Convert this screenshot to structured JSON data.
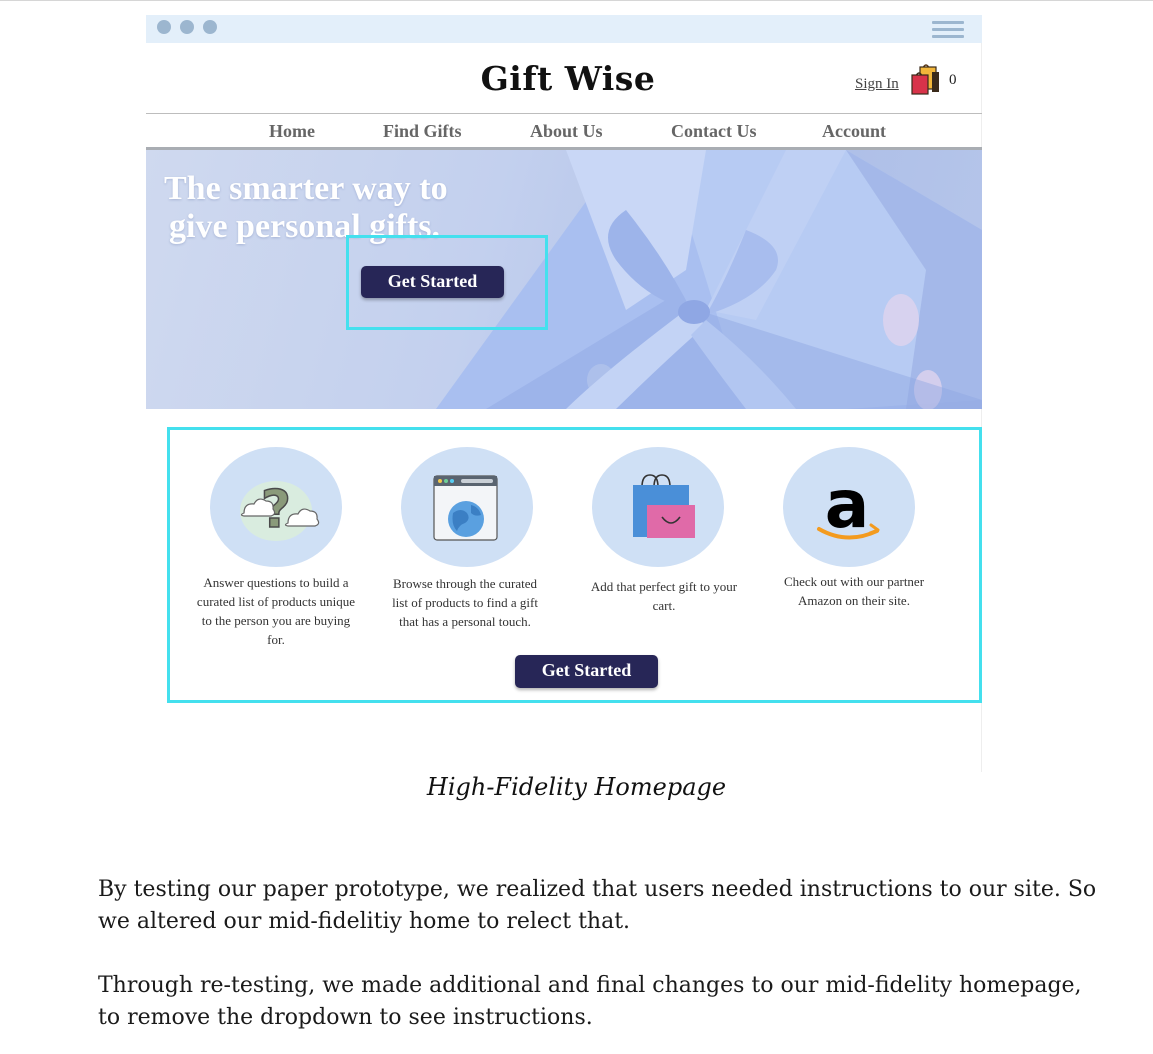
{
  "site": {
    "brand": "Gift Wise",
    "sign_in": "Sign In",
    "cart_count": "0",
    "cart_icon": "shopping-bags-icon",
    "menu_icon": "hamburger-menu-icon"
  },
  "nav": {
    "items": [
      {
        "label": "Home"
      },
      {
        "label": "Find Gifts"
      },
      {
        "label": "About Us"
      },
      {
        "label": "Contact Us"
      },
      {
        "label": "Account"
      }
    ]
  },
  "hero": {
    "line1": "The smarter way to",
    "line2": "give personal gifts.",
    "button": "Get Started"
  },
  "steps": {
    "items": [
      {
        "icon": "question-cloud-icon",
        "text": "Answer questions to build a curated list of products unique to the person you are buying for."
      },
      {
        "icon": "browser-globe-icon",
        "text": "Browse through the curated list of products to find a gift that has a personal touch."
      },
      {
        "icon": "shopping-bags-icon",
        "text": "Add that perfect gift to your cart."
      },
      {
        "icon": "amazon-logo-icon",
        "text": "Check out with our partner Amazon on their site."
      }
    ],
    "button": "Get Started"
  },
  "caption": "High-Fidelity Homepage",
  "paragraphs": [
    "By testing our paper prototype, we realized that users needed instructions to our site. So we altered our mid-fidelitiy home to relect that.",
    "Through re-testing, we made additional and final changes to our mid-fidelity homepage, to remove the dropdown to see instructions."
  ],
  "colors": {
    "highlight": "#44e0ee",
    "button": "#272657",
    "chrome": "#e3effa",
    "circle": "#cfe0f5"
  }
}
